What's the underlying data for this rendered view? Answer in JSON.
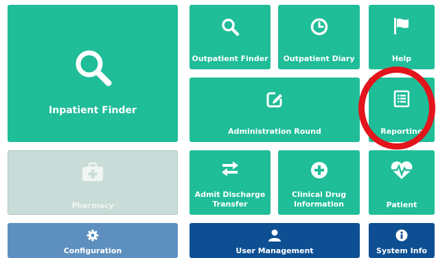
{
  "tiles": {
    "inpatient_finder": {
      "label": "Inpatient Finder",
      "icon": "search-icon"
    },
    "outpatient_finder": {
      "label": "Outpatient Finder",
      "icon": "search-icon"
    },
    "outpatient_diary": {
      "label": "Outpatient Diary",
      "icon": "clock-icon"
    },
    "help": {
      "label": "Help",
      "icon": "flag-icon"
    },
    "administration_round": {
      "label": "Administration Round",
      "icon": "edit-icon"
    },
    "reporting": {
      "label": "Reporting",
      "icon": "report-list-icon"
    },
    "pharmacy": {
      "label": "Pharmacy",
      "icon": "medical-kit-icon",
      "disabled": true
    },
    "admit_discharge_transfer": {
      "label": "Admit Discharge\nTransfer",
      "icon": "exchange-arrows-icon"
    },
    "clinical_drug_information": {
      "label": "Clinical Drug\nInformation",
      "icon": "plus-circle-icon"
    },
    "patient": {
      "label": "Patient",
      "icon": "heartbeat-icon"
    },
    "configuration": {
      "label": "Configuration",
      "icon": "gear-icon"
    },
    "user_management": {
      "label": "User Management",
      "icon": "user-icon"
    },
    "system_info": {
      "label": "System Info",
      "icon": "info-circle-icon"
    }
  },
  "colors": {
    "teal": "#1fbd98",
    "disabled": "#c9dcd8",
    "steel_blue": "#5d90bf",
    "navy": "#0d4f92",
    "highlight_ring": "#e3141b"
  }
}
